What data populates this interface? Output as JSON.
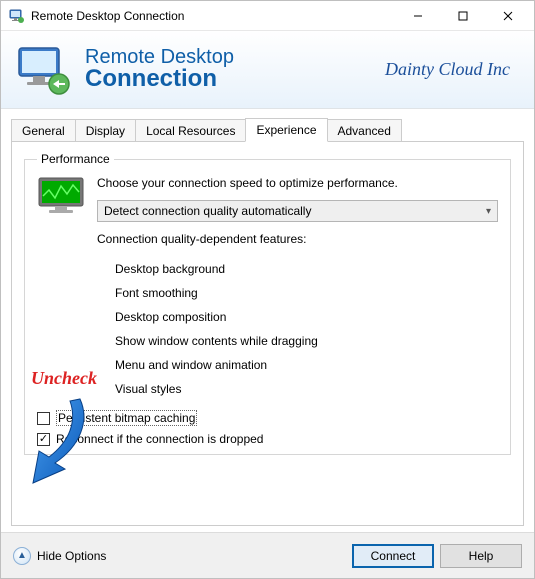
{
  "window": {
    "title": "Remote Desktop Connection"
  },
  "banner": {
    "line1": "Remote Desktop",
    "line2": "Connection",
    "brand": "Dainty Cloud Inc"
  },
  "tabs": {
    "items": [
      "General",
      "Display",
      "Local Resources",
      "Experience",
      "Advanced"
    ],
    "active": "Experience"
  },
  "performance": {
    "legend": "Performance",
    "intro": "Choose your connection speed to optimize performance.",
    "combo_value": "Detect connection quality automatically",
    "features_heading": "Connection quality-dependent features:",
    "features": [
      "Desktop background",
      "Font smoothing",
      "Desktop composition",
      "Show window contents while dragging",
      "Menu and window animation",
      "Visual styles"
    ]
  },
  "annotation": {
    "uncheck": "Uncheck"
  },
  "checkboxes": {
    "bitmap_cache": {
      "label": "Persistent bitmap caching",
      "checked": false
    },
    "reconnect": {
      "label": "Reconnect if the connection is dropped",
      "checked": true
    }
  },
  "footer": {
    "hide_options": "Hide Options",
    "connect": "Connect",
    "help": "Help"
  }
}
